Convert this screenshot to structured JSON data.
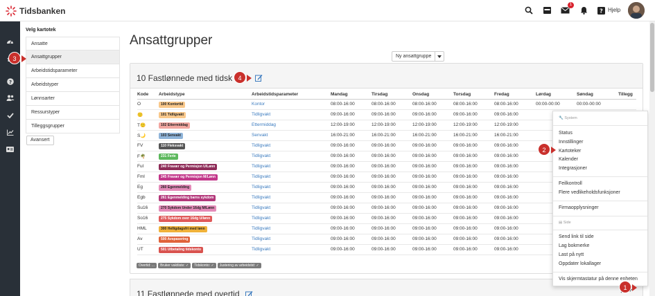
{
  "header": {
    "logo_text": "Tidsbanken",
    "notification_count": "1",
    "help_label": "Hjelp",
    "accent": "#d9232e"
  },
  "sidebar": {
    "title": "Velg kartotek",
    "items": [
      {
        "label": "Ansatte"
      },
      {
        "label": "Ansattgrupper"
      },
      {
        "label": "Arbeidstidsparameter"
      },
      {
        "label": "Arbeidstyper"
      },
      {
        "label": "Lønnsarter"
      },
      {
        "label": "Ressurstyper"
      },
      {
        "label": "Tilleggsgrupper"
      }
    ],
    "advanced_label": "Avansert"
  },
  "main": {
    "title": "Ansattgrupper",
    "new_group_label": "Ny ansattgruppe",
    "panel1": {
      "title": "10 Fastlønnede med tidsk",
      "columns": [
        "Kode",
        "Arbeidstype",
        "Arbeidstidsparameter",
        "Mandag",
        "Tirsdag",
        "Onsdag",
        "Torsdag",
        "Fredag",
        "Lørdag",
        "Søndag",
        "Tillegg"
      ],
      "rows": [
        {
          "code": "O",
          "type": "100 Kontortid",
          "type_color": "#f9c88b",
          "param": "Kontor",
          "mon": "08:00-16:00",
          "tue": "08:00-16:00",
          "wed": "08:00-16:00",
          "thu": "08:00-16:00",
          "fri": "08:00-16:00",
          "sat": "00:00-00:00",
          "sun": "00:00-00:00"
        },
        {
          "code": "🙂",
          "type": "101 Tidligvakt",
          "type_color": "#f9c88b",
          "param": "Tidligvakt",
          "mon": "09:00-16:00",
          "tue": "09:00-16:00",
          "wed": "09:00-16:00",
          "thu": "09:00-16:00",
          "fri": "09:00-16:00",
          "sat": "",
          "sun": ""
        },
        {
          "code": "T🙂",
          "type": "102 Ettermiddag",
          "type_color": "#f2a6a0",
          "param": "Ettermiddag",
          "mon": "12:00-19:00",
          "tue": "12:00-19:00",
          "wed": "12:00-19:00",
          "thu": "12:00-19:00",
          "fri": "12:00-19:00",
          "sat": "",
          "sun": ""
        },
        {
          "code": "S🌙",
          "type": "103 Senvakt",
          "type_color": "#8fb4d9",
          "param": "Senvakt",
          "mon": "16:00-21:00",
          "tue": "16:00-21:00",
          "wed": "16:00-21:00",
          "thu": "16:00-21:00",
          "fri": "16:00-21:00",
          "sat": "",
          "sun": ""
        },
        {
          "code": "FV",
          "type": "110 Fleksvakt",
          "type_color": "#555555",
          "param": "Tidligvakt",
          "mon": "09:00-16:00",
          "tue": "09:00-16:00",
          "wed": "09:00-16:00",
          "thu": "09:00-16:00",
          "fri": "09:00-16:00",
          "sat": "",
          "sun": ""
        },
        {
          "code": "F🌴",
          "type": "231 Ferie",
          "type_color": "#5cb85c",
          "param": "Tidligvakt",
          "mon": "09:00-16:00",
          "tue": "09:00-16:00",
          "wed": "09:00-16:00",
          "thu": "09:00-16:00",
          "fri": "09:00-16:00",
          "sat": "",
          "sun": ""
        },
        {
          "code": "Ful",
          "type": "240 Fravær og Permisjon U/Lønn",
          "type_color": "#8e2c58",
          "param": "Tidligvakt",
          "mon": "09:00-16:00",
          "tue": "09:00-16:00",
          "wed": "09:00-16:00",
          "thu": "09:00-16:00",
          "fri": "09:00-16:00",
          "sat": "",
          "sun": ""
        },
        {
          "code": "Fml",
          "type": "245 Fravær og Permisjon M/Lønn",
          "type_color": "#c2378a",
          "param": "Tidligvakt",
          "mon": "09:00-16:00",
          "tue": "09:00-16:00",
          "wed": "09:00-16:00",
          "thu": "09:00-16:00",
          "fri": "09:00-16:00",
          "sat": "",
          "sun": ""
        },
        {
          "code": "Eg",
          "type": "260 Egenmelding",
          "type_color": "#e38bb8",
          "param": "Tidligvakt",
          "mon": "09:00-16:00",
          "tue": "09:00-16:00",
          "wed": "09:00-16:00",
          "thu": "09:00-16:00",
          "fri": "09:00-16:00",
          "sat": "",
          "sun": ""
        },
        {
          "code": "Egb",
          "type": "261 Egenmelding barns sykdom",
          "type_color": "#b3387a",
          "param": "Tidligvakt",
          "mon": "09:00-16:00",
          "tue": "09:00-16:00",
          "wed": "09:00-16:00",
          "thu": "09:00-16:00",
          "fri": "09:00-16:00",
          "sat": "",
          "sun": ""
        },
        {
          "code": "Su16",
          "type": "270 Sykdom Under 16dg M/Lønn",
          "type_color": "#e38bb8",
          "param": "Tidligvakt",
          "mon": "09:00-16:00",
          "tue": "09:00-16:00",
          "wed": "09:00-16:00",
          "thu": "09:00-16:00",
          "fri": "09:00-16:00",
          "sat": "",
          "sun": ""
        },
        {
          "code": "So16",
          "type": "275 Sykdom over 16dg U/lønn",
          "type_color": "#e05a5a",
          "param": "Tidligvakt",
          "mon": "09:00-16:00",
          "tue": "09:00-16:00",
          "wed": "09:00-16:00",
          "thu": "09:00-16:00",
          "fri": "09:00-16:00",
          "sat": "",
          "sun": ""
        },
        {
          "code": "HML",
          "type": "300 Helligdagsfri med lønn",
          "type_color": "#f0b23a",
          "param": "Tidligvakt",
          "mon": "09:00-16:00",
          "tue": "09:00-16:00",
          "wed": "09:00-16:00",
          "thu": "09:00-16:00",
          "fri": "09:00-16:00",
          "sat": "",
          "sun": ""
        },
        {
          "code": "Av",
          "type": "500 Avspasering",
          "type_color": "#e0633a",
          "param": "Tidligvakt",
          "mon": "09:00-16:00",
          "tue": "09:00-16:00",
          "wed": "09:00-16:00",
          "thu": "09:00-16:00",
          "fri": "09:00-16:00",
          "sat": "",
          "sun": ""
        },
        {
          "code": "UT",
          "type": "501 Utbetaling tidskonto",
          "type_color": "#d9534f",
          "param": "Tidligvakt",
          "mon": "09:00-16:00",
          "tue": "09:00-16:00",
          "wed": "09:00-16:00",
          "thu": "09:00-16:00",
          "fri": "09:00-16:00",
          "sat": "",
          "sun": ""
        }
      ],
      "footer_tags": [
        "Overtid: ...",
        "Bruker vaktliste: ✓",
        "Tidskonto: ✓",
        "Justering av arbeidstid: ✓"
      ]
    },
    "panel2": {
      "title": "11 Fastlønnede med overtid"
    }
  },
  "dropdown": {
    "section_system": "System",
    "status": "Status",
    "settings": "Innstillinger",
    "registers": "Kartoteker",
    "calendar": "Kalender",
    "integrations": "Integrasjoner",
    "error_control": "Feilkontroll",
    "maintenance": "Flere vedlikeholdsfunksjoner",
    "company_info": "Firmaopplysninger",
    "section_page": "Side",
    "send_link": "Send link til side",
    "bookmark": "Lag bokmerke",
    "reload": "Last på nytt",
    "update_local": "Oppdater lokallager",
    "keyboard": "Vis skjermtastatur på denne enheten"
  },
  "steps": {
    "one": "1",
    "two": "2",
    "three": "3",
    "four": "4"
  }
}
